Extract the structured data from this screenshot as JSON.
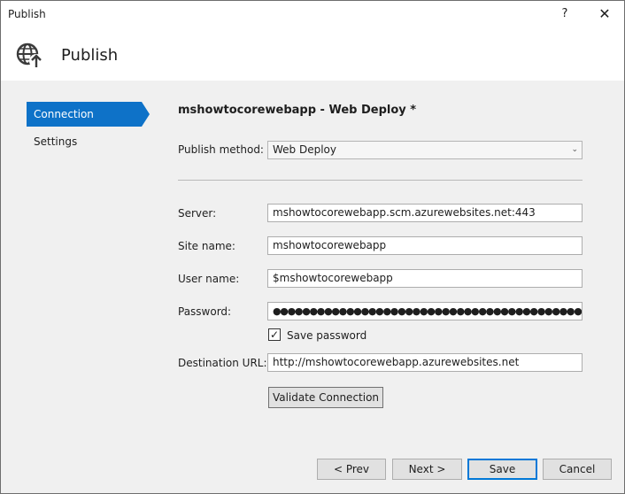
{
  "window": {
    "title": "Publish",
    "help_label": "?",
    "close_label": "✕"
  },
  "header": {
    "title": "Publish",
    "icon": "globe-publish-icon"
  },
  "nav": {
    "items": [
      {
        "label": "Connection",
        "active": true
      },
      {
        "label": "Settings",
        "active": false
      }
    ]
  },
  "form": {
    "profile_title": "mshowtocorewebapp - Web Deploy *",
    "publish_method": {
      "label": "Publish method:",
      "value": "Web Deploy"
    },
    "server": {
      "label": "Server:",
      "value": "mshowtocorewebapp.scm.azurewebsites.net:443"
    },
    "site_name": {
      "label": "Site name:",
      "value": "mshowtocorewebapp"
    },
    "user_name": {
      "label": "User name:",
      "value": "$mshowtocorewebapp"
    },
    "password": {
      "label": "Password:",
      "value": "●●●●●●●●●●●●●●●●●●●●●●●●●●●●●●●●●●●●●●●●●●●●●●●●●●●●●●●●●●●●●"
    },
    "save_password": {
      "label": "Save password",
      "checked": true,
      "mark": "✓"
    },
    "destination_url": {
      "label": "Destination URL:",
      "value": "http://mshowtocorewebapp.azurewebsites.net"
    },
    "validate_label": "Validate Connection"
  },
  "footer": {
    "prev_label": "< Prev",
    "next_label": "Next >",
    "save_label": "Save",
    "cancel_label": "Cancel"
  },
  "colors": {
    "accent": "#0e72c8",
    "content_bg": "#f0f0f0"
  }
}
